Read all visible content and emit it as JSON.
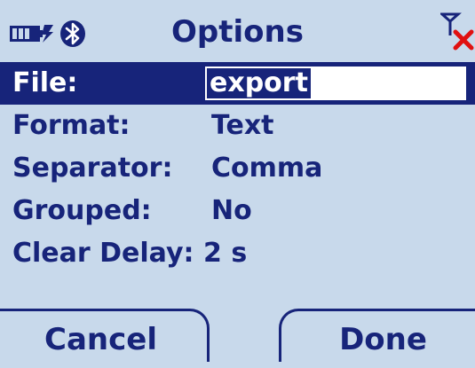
{
  "status": {
    "title": "Options",
    "battery_icon": "battery-charging-icon",
    "bluetooth_icon": "bluetooth-icon",
    "signal_icon": "no-signal-icon"
  },
  "colors": {
    "background": "#c8d9eb",
    "accent": "#17247a",
    "error": "#e01010"
  },
  "options": [
    {
      "label": "File:",
      "value": "export",
      "selected": true
    },
    {
      "label": "Format:",
      "value": "Text"
    },
    {
      "label": "Separator:",
      "value": "Comma"
    },
    {
      "label": "Grouped:",
      "value": "No"
    },
    {
      "label": "Clear Delay:",
      "value": "2 s"
    }
  ],
  "softkeys": {
    "left": "Cancel",
    "right": "Done"
  }
}
